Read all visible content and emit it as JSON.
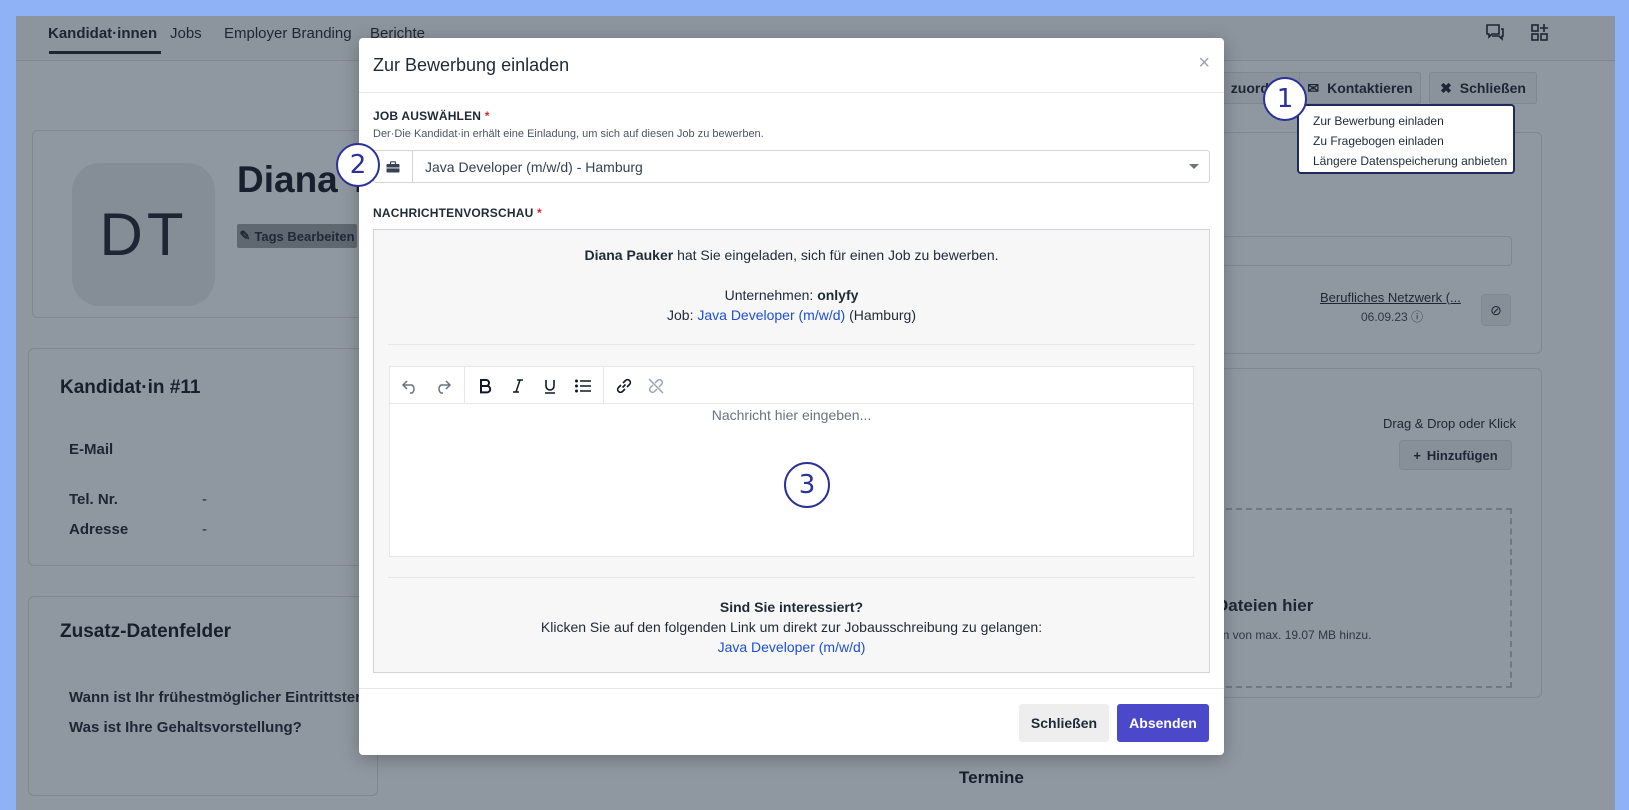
{
  "nav": {
    "tabs": [
      "Kandidat·innen",
      "Jobs",
      "Employer Branding",
      "Berichte"
    ],
    "icons": [
      "chat-icon",
      "apps-icon"
    ]
  },
  "candidate": {
    "initials": "DT",
    "name_partial": "Diana T",
    "tags_button": "Tags Bearbeiten",
    "section_title": "Kandidat·in #11",
    "fields": [
      {
        "label": "E-Mail",
        "value": ""
      },
      {
        "label": "Tel. Nr.",
        "value": "-"
      },
      {
        "label": "Adresse",
        "value": "-"
      }
    ],
    "extra_title": "Zusatz-Datenfelder",
    "extra_fields": [
      "Wann ist Ihr frühestmöglicher Eintrittstermin",
      "Was ist Ihre Gehaltsvorstellung?"
    ]
  },
  "actions": {
    "assign_partial": "zuordne",
    "contact": "Kontaktieren",
    "close": "Schließen"
  },
  "right_panel": {
    "network_link": "Berufliches Netzwerk (...",
    "network_date": "06.09.23",
    "drag_hint": "Drag & Drop oder Klick",
    "add_button": "Hinzufügen",
    "dropzone_title": "Dateien hier",
    "dropzone_sub": "en von max. 19.07 MB hinzu.",
    "termine": "Termine"
  },
  "dropdown_menu": [
    "Zur Bewerbung einladen",
    "Zu Fragebogen einladen",
    "Längere Datenspeicherung anbieten"
  ],
  "modal": {
    "title": "Zur Bewerbung einladen",
    "close_symbol": "×",
    "job_label": "JOB AUSWÄHLEN",
    "required_mark": "*",
    "job_help": "Der·Die Kandidat·in erhält eine Einladung, um sich auf diesen Job zu bewerben.",
    "job_selected": "Java Developer (m/w/d) - Hamburg",
    "preview_label": "NACHRICHTENVORSCHAU",
    "preview": {
      "inviter": "Diana Pauker",
      "invite_text": " hat Sie eingeladen, sich für einen Job zu bewerben.",
      "company_label": "Unternehmen: ",
      "company": "onlyfy",
      "job_label": "Job: ",
      "job": "Java Developer (m/w/d)",
      "job_location": " (Hamburg)",
      "editor_placeholder": "Nachricht hier eingeben...",
      "interested": "Sind Sie interessiert?",
      "link_text": "Klicken Sie auf den folgenden Link um direkt zur Jobausschreibung zu gelangen:",
      "link": "Java Developer (m/w/d)"
    },
    "buttons": {
      "close": "Schließen",
      "send": "Absenden"
    }
  },
  "callouts": [
    "1",
    "2",
    "3"
  ],
  "colors": {
    "primary": "#4b48c9",
    "link": "#1d4ed8",
    "required": "#dc2626",
    "callout": "#2a3199",
    "frame": "#8fb2f6"
  }
}
